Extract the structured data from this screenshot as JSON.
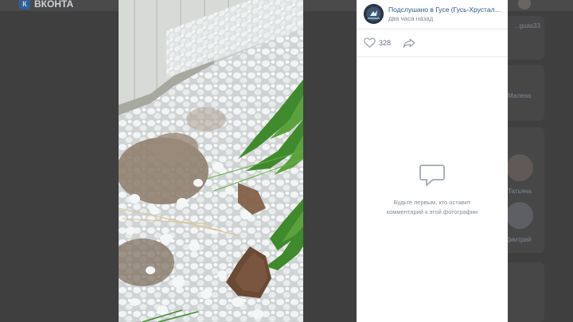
{
  "app": {
    "logo_text": "ВКОНТА"
  },
  "background": {
    "right_texts": [
      "...guas33",
      "Малена",
      "Татьяна",
      "Дмитрий"
    ]
  },
  "photo": {
    "description_icon": "hail-photo"
  },
  "post": {
    "author_name": "Подслушано в Гусе (Гусь-Хрустальный)",
    "author_name_visible": "Подслушано в Гусе (Гусь-Хрусталь...",
    "time": "два часа назад",
    "like_count": "328",
    "like_icon": "heart-icon",
    "share_icon": "share-icon"
  },
  "comments": {
    "empty_icon": "comment-icon",
    "empty_line1": "Будьте первым, кто оставит",
    "empty_line2": "комментарий к этой фотографии"
  }
}
